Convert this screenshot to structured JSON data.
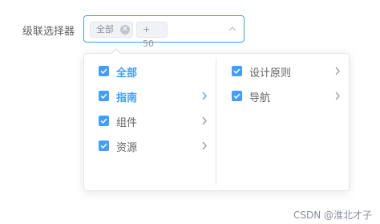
{
  "form": {
    "label": "级联选择器"
  },
  "cascader": {
    "tags": [
      {
        "text": "全部",
        "closable": true
      },
      {
        "text": "+ 50",
        "closable": false
      }
    ],
    "tag_close_glyph": "✕",
    "expanded": true
  },
  "menu_level1": [
    {
      "label": "全部",
      "checked": true,
      "active": true,
      "has_children": false
    },
    {
      "label": "指南",
      "checked": true,
      "active": true,
      "has_children": true
    },
    {
      "label": "组件",
      "checked": true,
      "active": false,
      "has_children": true
    },
    {
      "label": "资源",
      "checked": true,
      "active": false,
      "has_children": true
    }
  ],
  "menu_level2": [
    {
      "label": "设计原则",
      "checked": true,
      "has_children": true
    },
    {
      "label": "导航",
      "checked": true,
      "has_children": true
    }
  ],
  "colors": {
    "accent": "#409eff",
    "text": "#606266",
    "tag_bg": "#f0f2f5",
    "border": "#e4e7ed"
  },
  "watermark": "CSDN @淮北才子"
}
